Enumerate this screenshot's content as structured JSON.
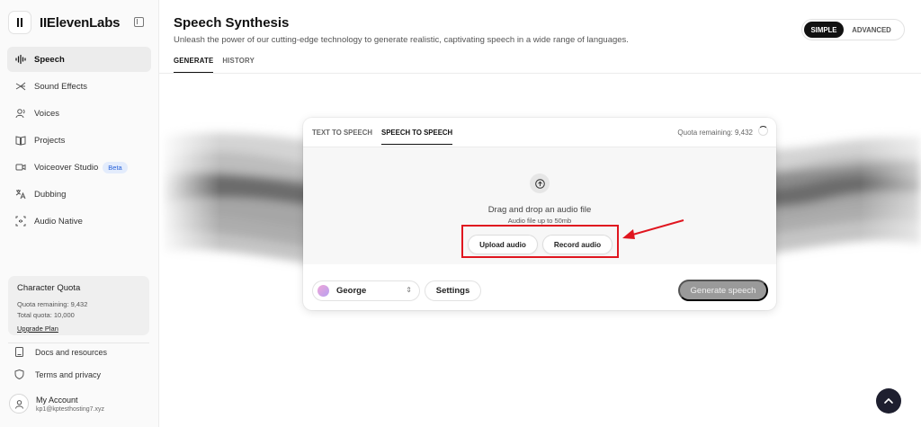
{
  "app": {
    "name": "IIElevenLabs"
  },
  "sidebar": {
    "items": [
      {
        "label": "Speech",
        "icon": "waveform-icon"
      },
      {
        "label": "Sound Effects",
        "icon": "sound-effects-icon"
      },
      {
        "label": "Voices",
        "icon": "voices-icon"
      },
      {
        "label": "Projects",
        "icon": "book-icon"
      },
      {
        "label": "Voiceover Studio",
        "icon": "video-icon",
        "badge": "Beta"
      },
      {
        "label": "Dubbing",
        "icon": "translate-icon"
      },
      {
        "label": "Audio Native",
        "icon": "audio-native-icon"
      }
    ],
    "quota": {
      "title": "Character Quota",
      "remaining": "Quota remaining: 9,432",
      "total": "Total quota: 10,000",
      "upgrade": "Upgrade Plan"
    },
    "links": {
      "docs": "Docs and resources",
      "terms": "Terms and privacy"
    },
    "account": {
      "name": "My Account",
      "email": "kp1@kptesthosting7.xyz"
    }
  },
  "header": {
    "title": "Speech Synthesis",
    "subtitle": "Unleash the power of our cutting-edge technology to generate realistic, captivating speech in a wide range of languages.",
    "tabs": [
      "GENERATE",
      "HISTORY"
    ],
    "mode": {
      "simple": "SIMPLE",
      "advanced": "ADVANCED",
      "selected": "SIMPLE"
    }
  },
  "card": {
    "tabs": [
      "TEXT TO SPEECH",
      "SPEECH TO SPEECH"
    ],
    "active_tab": "SPEECH TO SPEECH",
    "quota": "Quota remaining: 9,432",
    "drop_title": "Drag and drop an audio file",
    "drop_sub": "Audio file up to 50mb",
    "upload_label": "Upload audio",
    "record_label": "Record audio",
    "voice": "George",
    "settings_label": "Settings",
    "generate_label": "Generate speech"
  },
  "colors": {
    "annotation": "#e0161f",
    "primary": "#111111",
    "disabled": "#9a9a9a",
    "beta": "#2962d9"
  }
}
